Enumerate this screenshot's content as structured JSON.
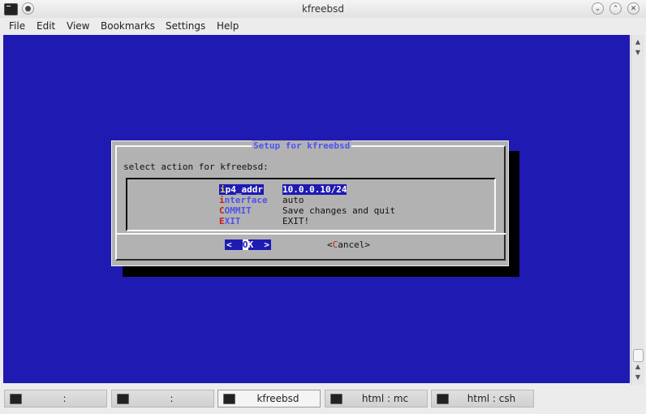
{
  "window": {
    "title": "kfreebsd"
  },
  "menu": {
    "items": [
      "File",
      "Edit",
      "View",
      "Bookmarks",
      "Settings",
      "Help"
    ]
  },
  "dialog": {
    "title": "Setup for kfreebsd",
    "prompt": "select action for kfreebsd:",
    "rows": [
      {
        "tag_hot": "i",
        "tag_rest": "p4_addr",
        "value": "10.0.0.10/24",
        "selected": true
      },
      {
        "tag_hot": "i",
        "tag_rest": "nterface",
        "value": "auto",
        "selected": false
      },
      {
        "tag_hot": "C",
        "tag_rest": "OMMIT",
        "value": "Save changes and quit",
        "selected": false
      },
      {
        "tag_hot": "E",
        "tag_rest": "XIT",
        "value": "EXIT!",
        "selected": false
      }
    ],
    "ok": {
      "left": "<  ",
      "hot": "O",
      "rest": "K  >"
    },
    "cancel": {
      "left": "<",
      "hot": "C",
      "rest": "ancel>"
    }
  },
  "tabs": [
    {
      "label": ":",
      "active": false
    },
    {
      "label": ":",
      "active": false
    },
    {
      "label": "kfreebsd",
      "active": true
    },
    {
      "label": "html : mc",
      "active": false
    },
    {
      "label": "html : csh",
      "active": false
    }
  ],
  "colors": {
    "terminal_bg": "#1e1ab2",
    "dialog_bg": "#b2b2b2",
    "title_fg": "#4b54f0",
    "hotkey": "#c21e1e"
  }
}
